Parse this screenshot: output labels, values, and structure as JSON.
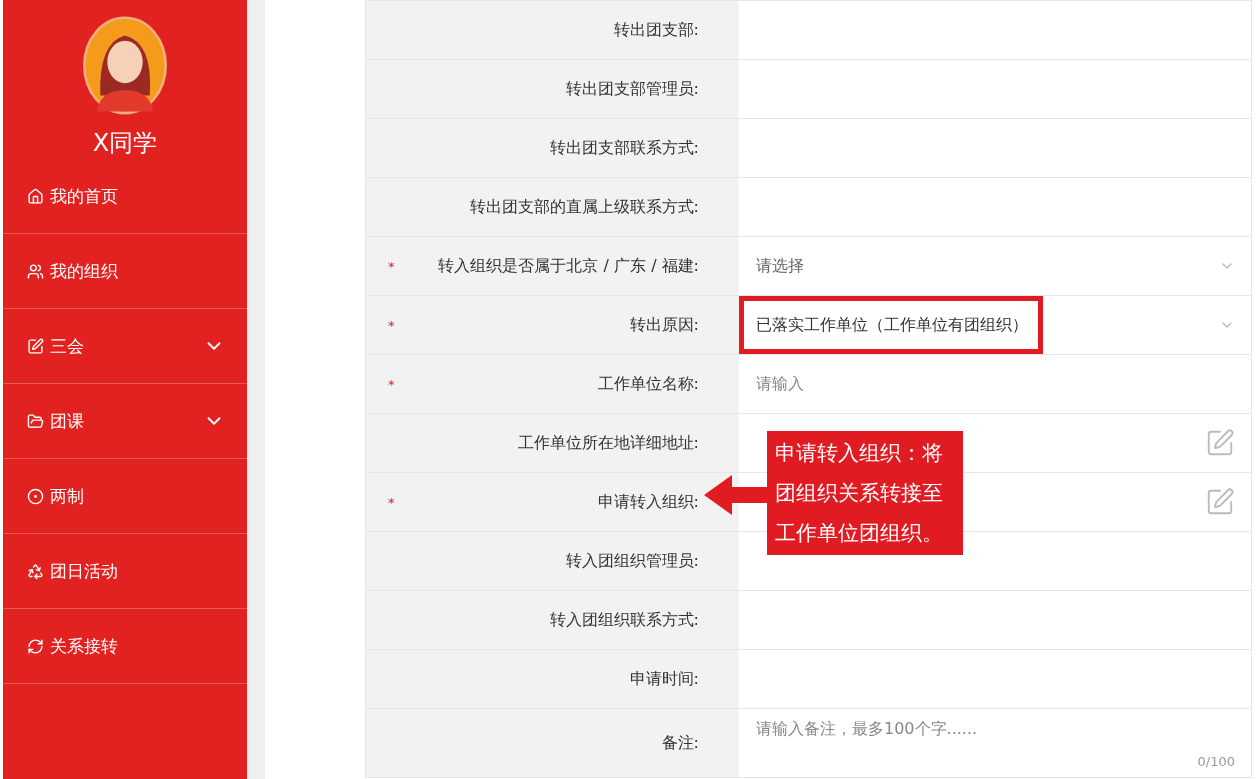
{
  "sidebar": {
    "user_name": "X同学",
    "items": [
      {
        "label": "我的首页",
        "expandable": false
      },
      {
        "label": "我的组织",
        "expandable": false
      },
      {
        "label": "三会",
        "expandable": true
      },
      {
        "label": "团课",
        "expandable": true
      },
      {
        "label": "两制",
        "expandable": false
      },
      {
        "label": "团日活动",
        "expandable": false
      },
      {
        "label": "关系接转",
        "expandable": false
      }
    ]
  },
  "form": {
    "rows": [
      {
        "label": "转出团支部:",
        "kind": "text"
      },
      {
        "label": "转出团支部管理员:",
        "kind": "text"
      },
      {
        "label": "转出团支部联系方式:",
        "kind": "text"
      },
      {
        "label": "转出团支部的直属上级联系方式:",
        "kind": "text"
      },
      {
        "label": "转入组织是否属于北京 / 广东 / 福建:",
        "required_mark": "*",
        "kind": "select",
        "placeholder": "请选择",
        "highlighted": false
      },
      {
        "label": "转出原因:",
        "required_mark": "*",
        "kind": "select",
        "value": "已落实工作单位（工作单位有团组织）",
        "highlighted": true
      },
      {
        "label": "工作单位名称:",
        "required_mark": "*",
        "kind": "input",
        "placeholder": "请输入"
      },
      {
        "label": "工作单位所在地详细地址:",
        "kind": "picker"
      },
      {
        "label": "申请转入组织:",
        "required_mark": "*",
        "kind": "picker"
      },
      {
        "label": "转入团组织管理员:",
        "kind": "text"
      },
      {
        "label": "转入团组织联系方式:",
        "kind": "text"
      },
      {
        "label": "申请时间:",
        "kind": "text"
      },
      {
        "label": "备注:",
        "kind": "textarea",
        "placeholder": "请输入备注，最多100个字......",
        "counter": "0/100"
      }
    ],
    "callout": {
      "lines": [
        "申请转入组织：将",
        "团组织关系转接至",
        "工作单位团组织。"
      ]
    }
  }
}
